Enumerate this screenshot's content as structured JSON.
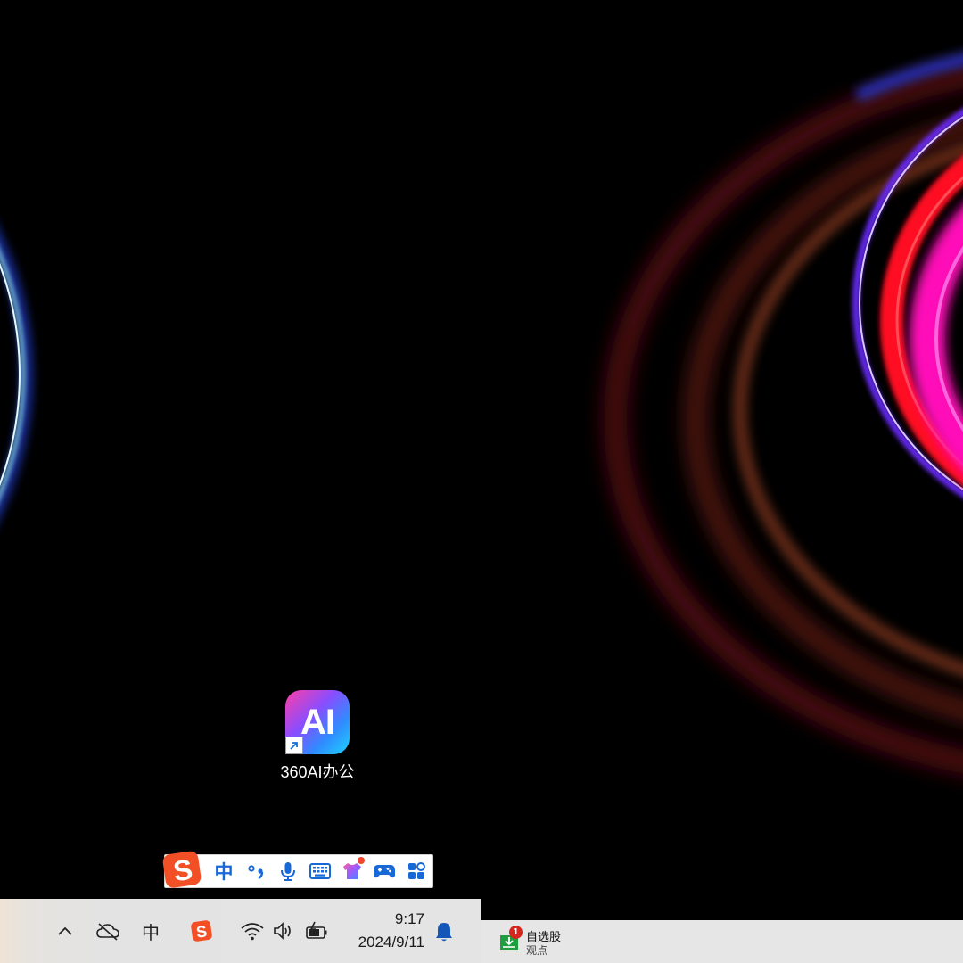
{
  "desktop": {
    "shortcut": {
      "icon_text": "AI",
      "label": "360AI办公",
      "icon": "ai-app-icon"
    }
  },
  "ime_toolbar": {
    "logo": "sogou-logo-icon",
    "mode_label": "中",
    "items": [
      "punctuation-icon",
      "microphone-icon",
      "keyboard-icon",
      "skin-icon",
      "gamepad-icon",
      "toolbox-icon"
    ]
  },
  "taskbar": {
    "tray": {
      "ime_label": "中",
      "icons": [
        "chevron-up-icon",
        "onedrive-offline-icon",
        "sogou-tray-icon",
        "wifi-icon",
        "volume-icon",
        "battery-charging-icon",
        "bell-icon"
      ]
    },
    "clock": {
      "time": "9:17",
      "date": "2024/9/11"
    },
    "stock_widget": {
      "badge": "1",
      "title": "自选股",
      "subtitle": "观点"
    }
  },
  "colors": {
    "ime_blue": "#1769d8",
    "sogou_orange": "#f24f26",
    "badge_red": "#d7261f",
    "stock_green": "#1e9e3e"
  }
}
